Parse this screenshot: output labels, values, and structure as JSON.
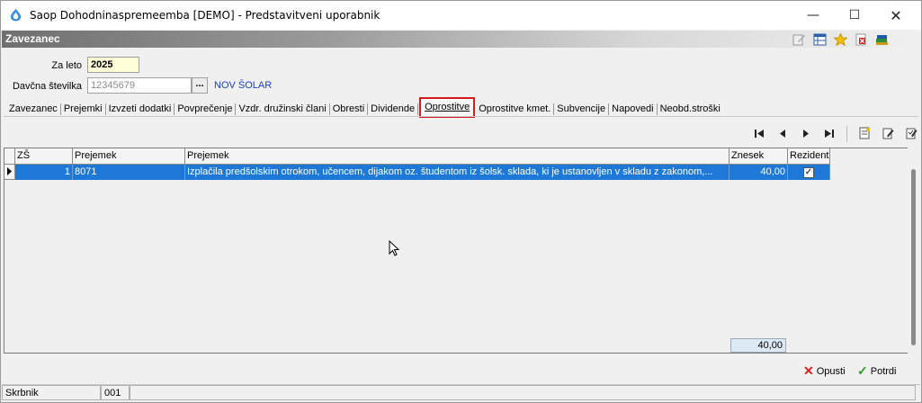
{
  "window": {
    "title": "Saop Dohodninaspremeemba [DEMO] - Predstavitveni uporabnik",
    "controls": {
      "minimize": "—",
      "maximize": "☐",
      "close": "✕"
    }
  },
  "header": {
    "label": "Zavezanec",
    "icons": [
      "edit-icon",
      "table-icon",
      "favorite-star-icon",
      "close-document-icon",
      "books-icon"
    ]
  },
  "form": {
    "year_label": "Za leto",
    "year_value": "2025",
    "tax_label": "Davčna številka",
    "tax_value": "12345679",
    "ellipsis": "...",
    "taxpayer_name": "NOV ŠOLAR"
  },
  "tabs": [
    {
      "label": "Zavezanec"
    },
    {
      "label": "Prejemki"
    },
    {
      "label": "Izvzeti dodatki"
    },
    {
      "label": "Povprečenje"
    },
    {
      "label": "Vzdr. družinski člani"
    },
    {
      "label": "Obresti"
    },
    {
      "label": "Dividende"
    },
    {
      "label": "Oprostitve",
      "active": true
    },
    {
      "label": "Oprostitve kmet."
    },
    {
      "label": "Subvencije"
    },
    {
      "label": "Napovedi"
    },
    {
      "label": "Neobd.stroški"
    }
  ],
  "grid": {
    "columns": [
      "ZŠ",
      "Prejemek",
      "Prejemek",
      "Znesek",
      "Rezident"
    ],
    "rows": [
      {
        "zs": "1",
        "code": "8071",
        "desc": "Izplačila predšolskim otrokom, učencem, dijakom oz. študentom iz šolsk. sklada, ki je ustanovljen v skladu z zakonom,...",
        "amount": "40,00",
        "resident": true
      }
    ],
    "total": "40,00"
  },
  "buttons": {
    "cancel": "Opusti",
    "confirm": "Potrdi"
  },
  "status": {
    "role": "Skrbnik",
    "code": "001"
  }
}
